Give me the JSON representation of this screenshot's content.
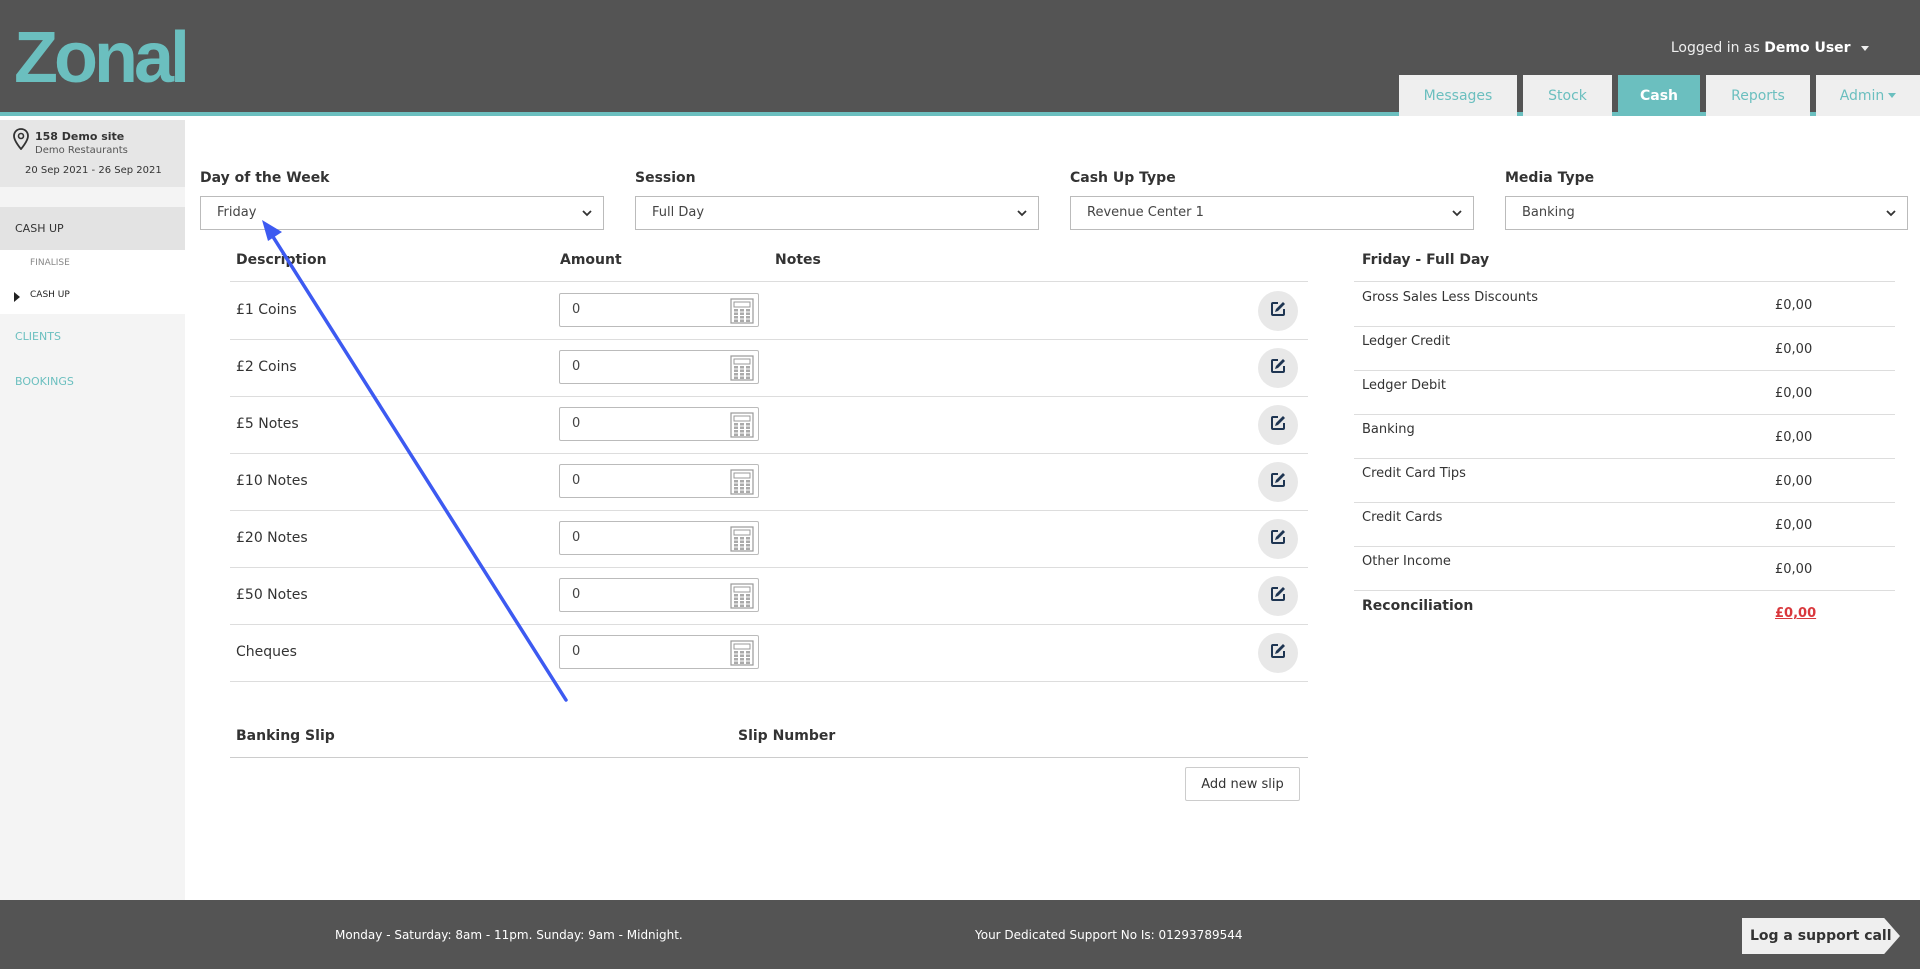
{
  "brand": {
    "logo_text": "Zonal",
    "accent": "#6bbfbf",
    "header_bg": "#545454"
  },
  "user": {
    "prefix": "Logged in as",
    "name": "Demo User"
  },
  "tabs": [
    {
      "label": "Messages"
    },
    {
      "label": "Stock"
    },
    {
      "label": "Cash"
    },
    {
      "label": "Reports"
    },
    {
      "label": "Admin"
    }
  ],
  "site": {
    "name": "158 Demo site",
    "group": "Demo Restaurants",
    "dates": "20 Sep 2021 - 26 Sep 2021"
  },
  "sidebar": {
    "cash_up": "CASH UP",
    "finalise": "FINALISE",
    "cash_up_sub": "CASH UP",
    "clients": "CLIENTS",
    "bookings": "BOOKINGS"
  },
  "filters": {
    "day": {
      "label": "Day of the Week",
      "value": "Friday"
    },
    "session": {
      "label": "Session",
      "value": "Full Day"
    },
    "cashup_type": {
      "label": "Cash Up Type",
      "value": "Revenue Center 1"
    },
    "media_type": {
      "label": "Media Type",
      "value": "Banking"
    }
  },
  "denominations": {
    "headers": {
      "description": "Description",
      "amount": "Amount",
      "notes": "Notes"
    },
    "rows": [
      {
        "description": "£1 Coins",
        "amount": "0"
      },
      {
        "description": "£2 Coins",
        "amount": "0"
      },
      {
        "description": "£5 Notes",
        "amount": "0"
      },
      {
        "description": "£10 Notes",
        "amount": "0"
      },
      {
        "description": "£20 Notes",
        "amount": "0"
      },
      {
        "description": "£50 Notes",
        "amount": "0"
      },
      {
        "description": "Cheques",
        "amount": "0"
      }
    ]
  },
  "banking_slip": {
    "header": "Banking Slip",
    "slip_number": "Slip Number",
    "add_button": "Add new slip"
  },
  "summary": {
    "title": "Friday - Full Day",
    "rows": [
      {
        "label": "Gross Sales Less Discounts",
        "value": "£0,00"
      },
      {
        "label": "Ledger Credit",
        "value": "£0,00"
      },
      {
        "label": "Ledger Debit",
        "value": "£0,00"
      },
      {
        "label": "Banking",
        "value": "£0,00"
      },
      {
        "label": "Credit Card Tips",
        "value": "£0,00"
      },
      {
        "label": "Credit Cards",
        "value": "£0,00"
      },
      {
        "label": "Other Income",
        "value": "£0,00"
      }
    ],
    "reconciliation": {
      "label": "Reconciliation",
      "value": "£0,00",
      "color": "#d9373c"
    }
  },
  "footer": {
    "hours": "Monday - Saturday: 8am - 11pm. Sunday: 9am - Midnight.",
    "support_no": "Your Dedicated Support No Is: 01293789544",
    "support_button": "Log a support call"
  }
}
